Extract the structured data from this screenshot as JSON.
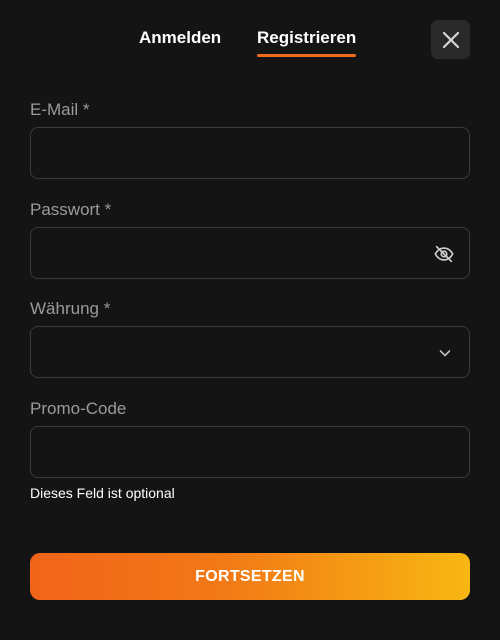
{
  "tabs": {
    "login_label": "Anmelden",
    "register_label": "Registrieren",
    "active": "register"
  },
  "close": {
    "icon": "close-icon"
  },
  "form": {
    "email": {
      "label": "E-Mail *",
      "value": "",
      "placeholder": ""
    },
    "password": {
      "label": "Passwort *",
      "value": "",
      "placeholder": "",
      "toggle_icon": "eye-off-icon"
    },
    "currency": {
      "label": "Währung *",
      "selected": "",
      "icon": "chevron-down-icon"
    },
    "promo": {
      "label": "Promo-Code",
      "value": "",
      "placeholder": "",
      "hint": "Dieses Feld ist optional"
    }
  },
  "submit": {
    "label": "FORTSETZEN"
  },
  "colors": {
    "background": "#141414",
    "accent": "#f26a1b",
    "gradient_end": "#f8b712",
    "field_border": "#3b3b3b",
    "label": "#9a9a9a"
  }
}
